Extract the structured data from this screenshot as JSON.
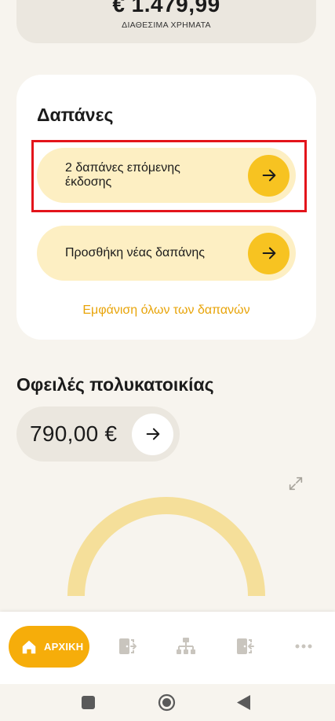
{
  "balance": {
    "amount": "€ 1.479,99",
    "label": "ΔΙΑΘΕΣΙΜΑ ΧΡΗΜΑΤΑ"
  },
  "expenses": {
    "title": "Δαπάνες",
    "items": [
      {
        "label": "2 δαπάνες επόμενης έκδοσης",
        "icon": "arrow-right-icon"
      },
      {
        "label": "Προσθήκη νέας δαπάνης",
        "icon": "arrow-right-icon"
      }
    ],
    "show_all": "Εμφάνιση όλων των δαπανών"
  },
  "dues": {
    "title": "Οφειλές πολυκατοικίας",
    "amount": "790,00 €",
    "icon": "arrow-right-icon"
  },
  "bottom_nav": {
    "home_label": "ΑΡΧΙΚΗ",
    "items": [
      "home-icon",
      "exit-door-icon",
      "hierarchy-icon",
      "enter-door-icon",
      "more-icon"
    ]
  },
  "colors": {
    "accent": "#f6ad0a",
    "pill_bg": "#fdefc3",
    "arrow_bg": "#f7c321",
    "highlight": "#e3141b",
    "gauge": "#f5df9a"
  }
}
